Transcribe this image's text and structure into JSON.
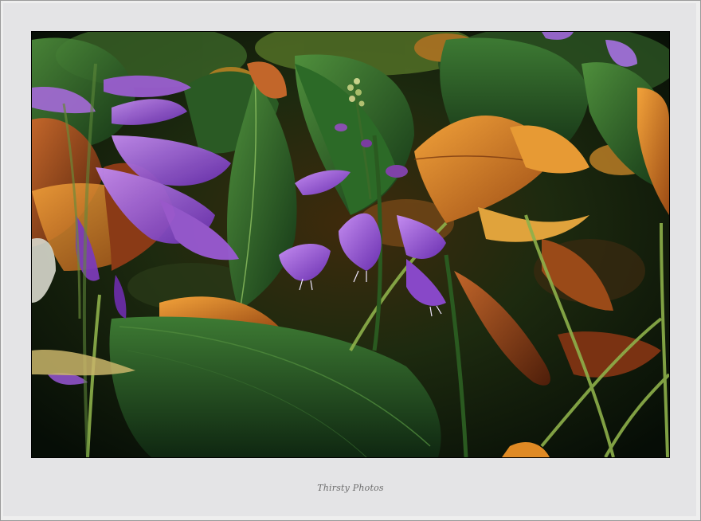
{
  "frame": {
    "background_color": "#e4e4e6",
    "photo_border_color": "#000000"
  },
  "photo": {
    "subject": "hosta-plant-with-purple-flowers-and-autumn-leaves",
    "palette": {
      "dark_green": "#0f2a12",
      "leaf_green": "#2f6a2c",
      "light_green": "#6aa24a",
      "orange": "#e08a24",
      "rust": "#8a3a16",
      "purple": "#8a4fd0",
      "light_purple": "#b47ae6"
    }
  },
  "caption": {
    "credit": "Thirsty Photos"
  }
}
